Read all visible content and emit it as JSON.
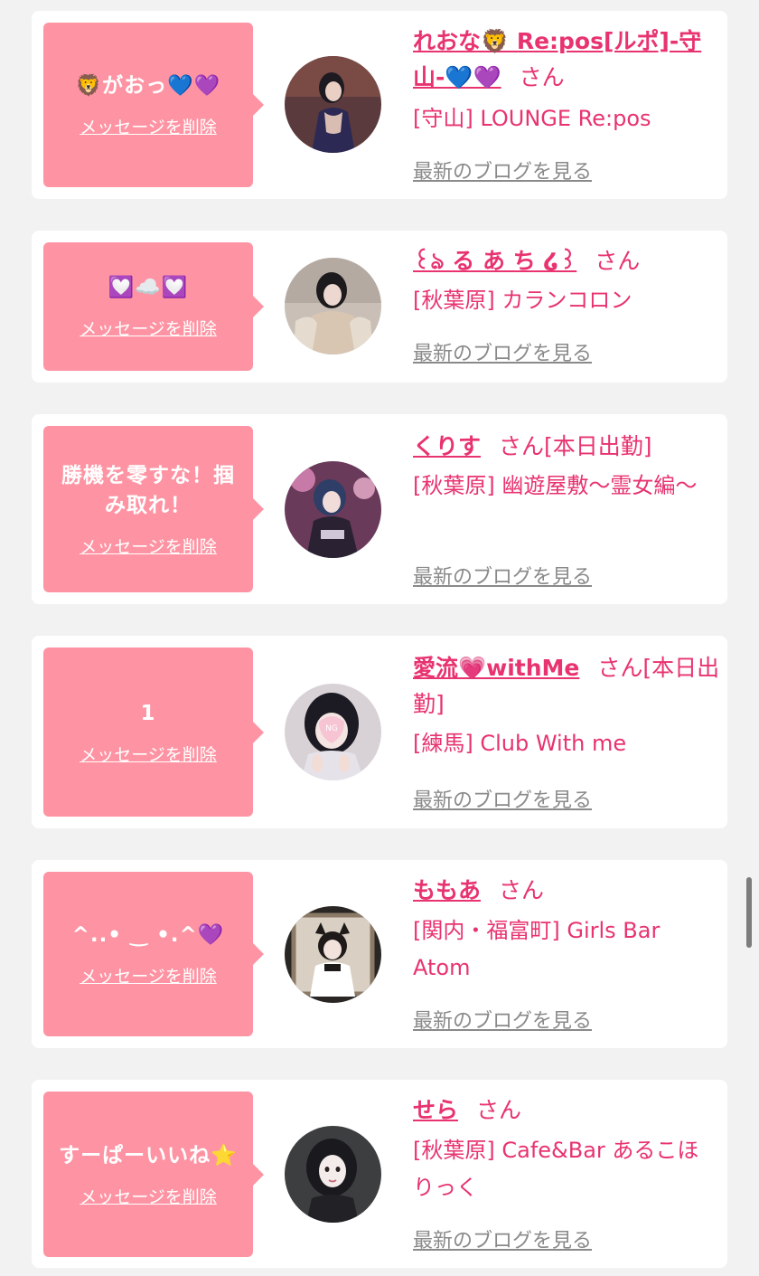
{
  "messages": [
    {
      "message": "🦁がおっ💙💜",
      "delete_label": "メッセージを削除",
      "name": "れおな🦁 Re:pos[ルポ]-守山-💙💜",
      "honorific": "さん",
      "status": "",
      "shop": "[守山] LOUNGE Re:pos",
      "blog_label": "最新のブログを見る"
    },
    {
      "message": "💟☁️💟",
      "delete_label": "メッセージを削除",
      "name": "꒰ঌ る あ ち ໒꒱",
      "honorific": "さん",
      "status": "",
      "shop": "[秋葉原] カランコロン",
      "blog_label": "最新のブログを見る"
    },
    {
      "message": "勝機を零すな！掴み取れ！",
      "delete_label": "メッセージを削除",
      "name": "くりす",
      "honorific": "さん",
      "status": "[本日出勤]",
      "shop": "[秋葉原] 幽遊屋敷〜霊女編〜",
      "blog_label": "最新のブログを見る"
    },
    {
      "message": "1",
      "delete_label": "メッセージを削除",
      "name": "愛流💗withMe",
      "honorific": "さん",
      "status": "[本日出勤]",
      "shop": "[練馬] Club With me",
      "blog_label": "最新のブログを見る"
    },
    {
      "message": "^..• ‿ •.^💜",
      "delete_label": "メッセージを削除",
      "name": "ももあ",
      "honorific": "さん",
      "status": "",
      "shop": "[関内・福富町] Girls Bar Atom",
      "blog_label": "最新のブログを見る"
    },
    {
      "message": "すーぱーいいね⭐",
      "delete_label": "メッセージを削除",
      "name": "せら",
      "honorific": "さん",
      "status": "",
      "shop": "[秋葉原] Cafe&Bar あるこほりっく",
      "blog_label": "最新のブログを見る"
    }
  ],
  "colors": {
    "page_bg": "#f2f2f2",
    "card_bg": "#ffffff",
    "bubble_bg": "#fe94a3",
    "accent": "#e8336f",
    "link_gray": "#8a8a8a"
  }
}
